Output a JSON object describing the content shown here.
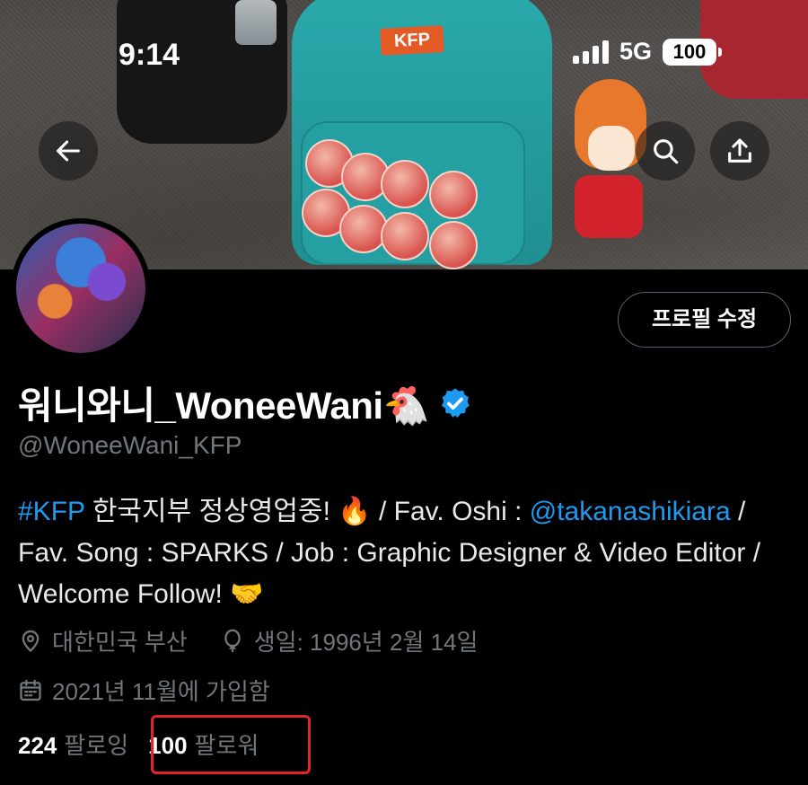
{
  "status_bar": {
    "time": "9:14",
    "network": "5G",
    "battery": "100"
  },
  "nav": {
    "back_icon": "arrow-left-icon",
    "search_icon": "search-icon",
    "share_icon": "share-icon"
  },
  "banner": {
    "kfp_label": "KFP"
  },
  "profile": {
    "edit_button": "프로필 수정",
    "display_name": "워니와니_WoneeWani",
    "name_emoji": "🐔",
    "verified": true,
    "handle": "@WoneeWani_KFP",
    "bio": {
      "hashtag": "#KFP",
      "text1": " 한국지부 정상영업중! ",
      "emoji1": "🔥",
      "text2": " / Fav. Oshi : ",
      "mention": "@takanashikiara",
      "text3": " / Fav. Song : SPARKS / Job : Graphic Designer & Video Editor / Welcome Follow! ",
      "emoji2": "🤝"
    },
    "location": "대한민국 부산",
    "birthday": "생일: 1996년 2월 14일",
    "joined": "2021년 11월에 가입함",
    "following_count": "224",
    "following_label": "팔로잉",
    "followers_count": "100",
    "followers_label": "팔로워"
  },
  "colors": {
    "accent": "#1d9bf0",
    "muted": "#71767b",
    "highlight": "#e0262a"
  }
}
